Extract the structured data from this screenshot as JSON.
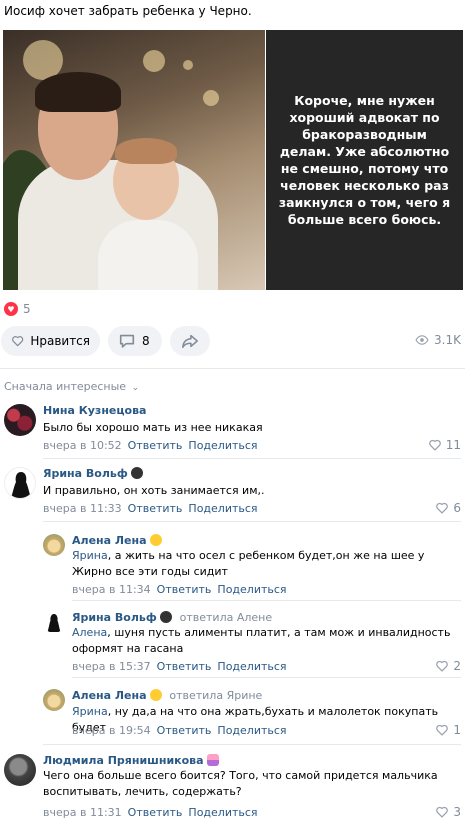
{
  "post": {
    "text": "Иосиф хочет забрать ребенка у Черно.",
    "quote": "Короче, мне нужен хороший адвокат по бракоразводным делам. Уже абсолютно не смешно, потому что человек несколько раз заикнулся о том, чего я больше всего боюсь.",
    "likes_count": "5",
    "like_button": "Нравится",
    "comments_count": "8",
    "views": "3.1K"
  },
  "sort_label": "Сначала интересные",
  "comments": [
    {
      "name": "Нина Кузнецова",
      "text": "Было бы хорошо мать из нее никакая",
      "time": "вчера в 10:52",
      "reply": "Ответить",
      "share": "Поделиться",
      "likes": "11"
    },
    {
      "name": "Ярина Вольф",
      "text": "И правильно, он хоть занимается им,.",
      "time": "вчера в 11:33",
      "reply": "Ответить",
      "share": "Поделиться",
      "likes": "6"
    },
    {
      "name": "Алена Лена",
      "addressee": "Ярина",
      "text": ", а жить на что осел с ребенком будет,он же на шее у Жирно все эти годы сидит",
      "time": "вчера в 11:34",
      "reply": "Ответить",
      "share": "Поделиться",
      "likes": ""
    },
    {
      "name": "Ярина Вольф",
      "replied_to": "ответила Алене",
      "addressee": "Алена",
      "text": ", шуня пусть алименты платит, а там мож и инвалидность оформят на гасана",
      "time": "вчера в 15:37",
      "reply": "Ответить",
      "share": "Поделиться",
      "likes": "2"
    },
    {
      "name": "Алена Лена",
      "replied_to": "ответила Ярине",
      "addressee": "Ярина",
      "text": ", ну да,а на что она жрать,бухать и малолеток покупать будет",
      "time": "вчера в 19:54",
      "reply": "Ответить",
      "share": "Поделиться",
      "likes": "1"
    },
    {
      "name": "Людмила Прянишникова",
      "text": "Чего она больше всего боится? Того, что самой придется мальчика воспитывать, лечить, содержать?",
      "time": "вчера в 11:31",
      "reply": "Ответить",
      "share": "Поделиться",
      "likes": "3"
    }
  ],
  "colors": {
    "link": "#2a5885",
    "muted": "#818c99",
    "like_red": "#ff3347",
    "button_bg": "#f0f2f5"
  }
}
